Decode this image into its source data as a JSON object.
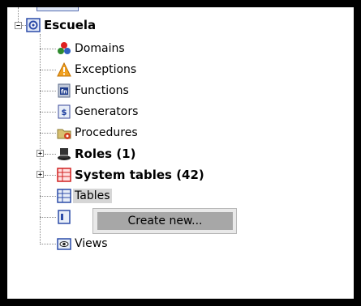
{
  "tree": {
    "root": {
      "label": "Escuela",
      "expander": "−",
      "icon": "database-icon"
    },
    "items": [
      {
        "label": "Domains",
        "icon": "domains-icon",
        "bold": false
      },
      {
        "label": "Exceptions",
        "icon": "warning-icon",
        "bold": false
      },
      {
        "label": "Functions",
        "icon": "function-icon",
        "bold": false
      },
      {
        "label": "Generators",
        "icon": "generator-icon",
        "bold": false
      },
      {
        "label": "Procedures",
        "icon": "procedures-icon",
        "bold": false
      },
      {
        "label": "Roles (1)",
        "icon": "roles-icon",
        "bold": true,
        "expander": "+"
      },
      {
        "label": "System tables (42)",
        "icon": "system-tables-icon",
        "bold": true,
        "expander": "+"
      },
      {
        "label": "Tables",
        "icon": "tables-icon",
        "bold": false,
        "selected": true
      },
      {
        "label": "",
        "icon": "triggers-icon",
        "bold": false
      },
      {
        "label": "Views",
        "icon": "views-icon",
        "bold": false
      }
    ]
  },
  "context_menu": {
    "items": [
      {
        "label": "Create new..."
      }
    ]
  },
  "colors": {
    "selection": "#d6d6d6",
    "menu_highlight": "#a7a7a7"
  }
}
